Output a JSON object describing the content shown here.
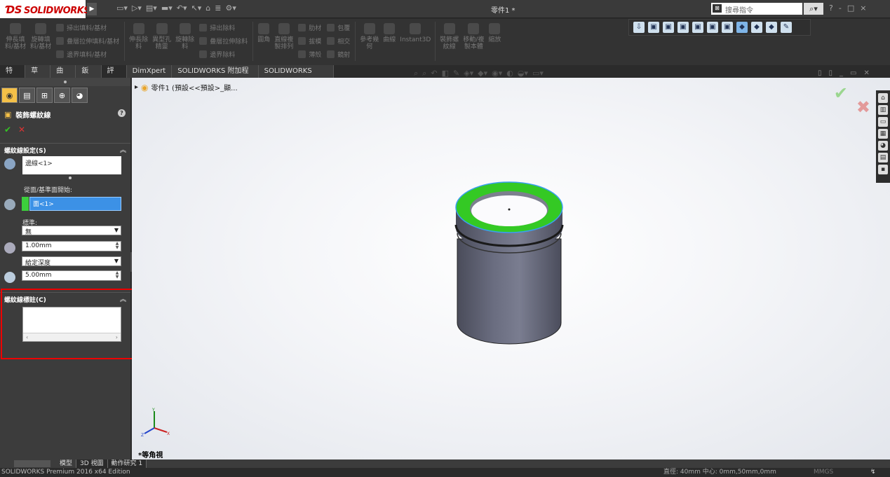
{
  "app": {
    "logo_text": "SOLIDWORKS",
    "document_title": "零件1 *",
    "search_placeholder": "搜尋指令",
    "window_controls": [
      "?",
      "-",
      "□",
      "×"
    ]
  },
  "ribbon": {
    "big_buttons": [
      {
        "label": "伸長填\n料/基材"
      },
      {
        "label": "旋轉填\n料/基材"
      }
    ],
    "small_col1": [
      "掃出填料/基材",
      "疊層拉伸填料/基材",
      "邊界填料/基材"
    ],
    "big_buttons2": [
      {
        "label": "伸長除\n料"
      },
      {
        "label": "異型孔\n精靈"
      },
      {
        "label": "旋轉除\n料"
      }
    ],
    "small_col2": [
      "掃出除料",
      "疊層拉伸除料",
      "邊界除料"
    ],
    "big_buttons3": [
      {
        "label": "圓角"
      },
      {
        "label": "直線複\n製排列"
      }
    ],
    "small_col3": [
      "肋材",
      "拔模",
      "薄殼"
    ],
    "small_col4": [
      "包覆",
      "相交",
      "鏡射"
    ],
    "big_buttons4": [
      {
        "label": "參考幾\n何"
      },
      {
        "label": "曲線"
      },
      {
        "label": "Instant3D"
      },
      {
        "label": "裝飾螺\n紋線"
      },
      {
        "label": "移動/複\n製本體"
      },
      {
        "label": "縮放"
      }
    ]
  },
  "tabs": [
    {
      "label": "特徵"
    },
    {
      "label": "草圖"
    },
    {
      "label": "曲面"
    },
    {
      "label": "鈑金"
    },
    {
      "label": "評估"
    },
    {
      "label": "DimXpert"
    },
    {
      "label": "SOLIDWORKS 附加程式"
    },
    {
      "label": "SOLIDWORKS MBD"
    }
  ],
  "property_manager": {
    "title": "裝飾螺紋線",
    "thread_settings_header": "螺紋線設定(S)",
    "edge_value": "邊線<1>",
    "start_label": "從面/基準面開始:",
    "face_value": "面<1>",
    "standard_label": "標準:",
    "standard_value": "無",
    "diameter_value": "1.00mm",
    "depth_type": "給定深度",
    "depth_value": "5.00mm",
    "thread_callout_header": "螺紋線標註(C)"
  },
  "viewport": {
    "tree_root": "零件1 (預設<<預設>_顯...",
    "view_label": "*等角視"
  },
  "model_tabs": [
    {
      "label": "模型"
    },
    {
      "label": "3D 視圖"
    },
    {
      "label": "動作研究 1"
    }
  ],
  "status": {
    "edition": "SOLIDWORKS Premium 2016 x64 Edition",
    "measure": "直徑: 40mm 中心: 0mm,50mm,0mm",
    "units": "MMGS"
  },
  "colors": {
    "selected_face_green": "#34c924",
    "selection_blue": "#3c91e6",
    "cancel_red": "#e00000"
  }
}
